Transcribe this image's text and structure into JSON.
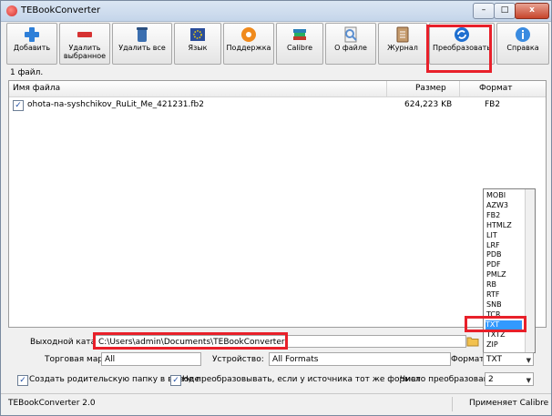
{
  "window": {
    "title": "TEBookConverter",
    "min": "–",
    "max": "□",
    "close": "x"
  },
  "toolbar": [
    {
      "name": "add-button",
      "icon": "plus-icon",
      "label": "Добавить",
      "color": "#2e7fd8"
    },
    {
      "name": "remove-selected-button",
      "icon": "minus-icon",
      "label": "Удалить выбранное",
      "color": "#d63232"
    },
    {
      "name": "remove-all-button",
      "icon": "trash-icon",
      "label": "Удалить все",
      "color": "#3b6fb0"
    },
    {
      "name": "language-button",
      "icon": "flag-icon",
      "label": "Язык",
      "color": "#2a4d9a"
    },
    {
      "name": "support-button",
      "icon": "support-icon",
      "label": "Поддержка",
      "color": "#f08a1c"
    },
    {
      "name": "calibre-button",
      "icon": "books-icon",
      "label": "Calibre",
      "color": "#c0392b"
    },
    {
      "name": "about-file-button",
      "icon": "magnifier-icon",
      "label": "О файле",
      "color": "#5b8fd0"
    },
    {
      "name": "journal-button",
      "icon": "journal-icon",
      "label": "Журнал",
      "color": "#a0683a"
    },
    {
      "name": "convert-button",
      "icon": "convert-icon",
      "label": "Преобразовать",
      "color": "#1f6fd0"
    },
    {
      "name": "help-button",
      "icon": "info-icon",
      "label": "Справка",
      "color": "#3a8be0"
    }
  ],
  "file_count": "1 файл.",
  "columns": {
    "name": "Имя файла",
    "size": "Размер",
    "format": "Формат"
  },
  "files": [
    {
      "checked": "✓",
      "name": "ohota-na-syshchikov_RuLit_Me_421231.fb2",
      "size": "624,223 KB",
      "format": "FB2"
    }
  ],
  "format_options": [
    "MOBI",
    "AZW3",
    "FB2",
    "HTMLZ",
    "LIT",
    "LRF",
    "PDB",
    "PDF",
    "PMLZ",
    "RB",
    "RTF",
    "SNB",
    "TCR",
    "TXT",
    "TXTZ",
    "ZIP"
  ],
  "selected_format_index": 13,
  "output": {
    "label": "Выходной каталог:",
    "path": "C:\\Users\\admin\\Documents\\TEBookConverter"
  },
  "brand": {
    "label": "Торговая марка:",
    "value": "All"
  },
  "device": {
    "label": "Устройство:",
    "value": "All Formats"
  },
  "format": {
    "label": "Формат:",
    "value": "TXT"
  },
  "options": {
    "create_parent_folder": "Создать родительскую папку в выводе",
    "skip_same_format": "Не преобразовывать, если у источника тот же формат",
    "check": "✓"
  },
  "conversions": {
    "label": "Число преобразований:",
    "value": "2"
  },
  "status": {
    "version": "TEBookConverter 2.0",
    "uses": "Применяет Calibre"
  },
  "colors": {
    "highlight": "#e8202a",
    "selection": "#3399ff"
  }
}
